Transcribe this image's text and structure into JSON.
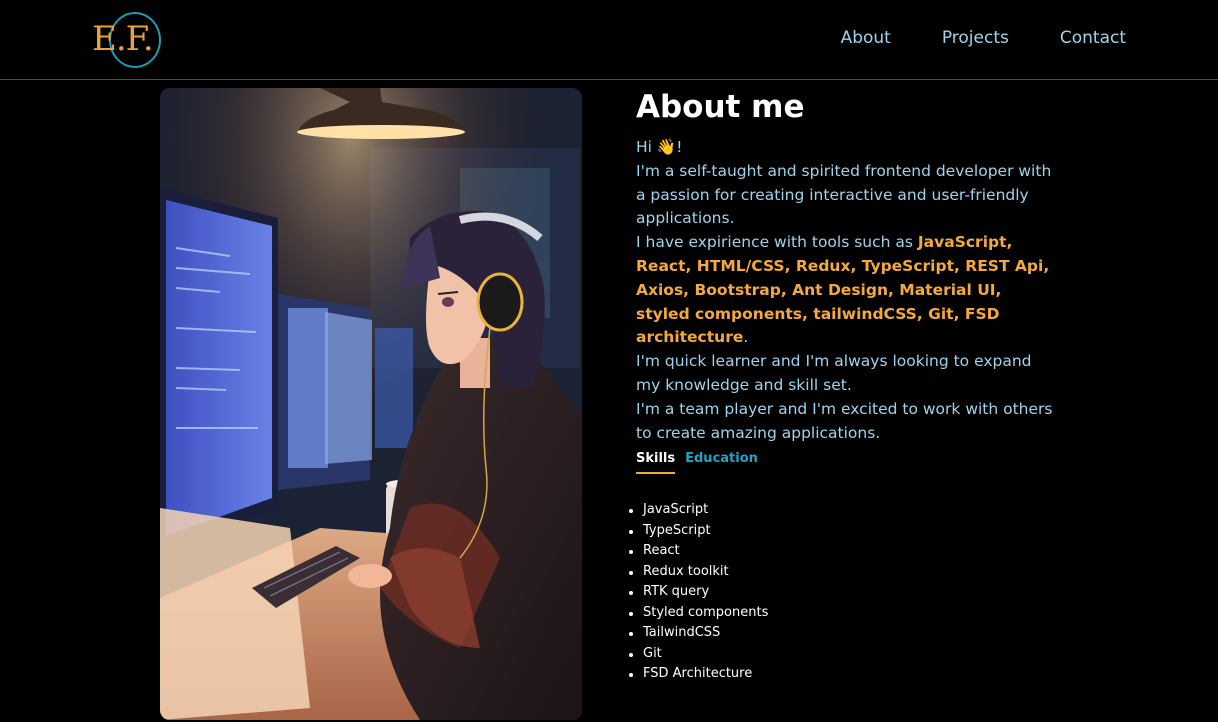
{
  "header": {
    "logo_text": "E.F.",
    "nav": [
      {
        "label": "About"
      },
      {
        "label": "Projects"
      },
      {
        "label": "Contact"
      }
    ]
  },
  "about": {
    "title": "About me",
    "greeting": "Hi 👋!",
    "intro": "I'm a self-taught and spirited frontend developer with a passion for creating interactive and user-friendly applications.",
    "tools_prefix": "I have expirience with tools such as ",
    "tools_list": "JavaScript, React, HTML/CSS, Redux, TypeScript, REST Api, Axios, Bootstrap, Ant Design, Material UI, styled components, tailwindCSS, Git, FSD architecture",
    "tools_suffix": ".",
    "learner": "I'm quick learner and I'm always looking to expand my knowledge and skill set.",
    "team": "I'm a team player and I'm excited to work with others to create amazing applications."
  },
  "tabs": [
    {
      "label": "Skills",
      "active": true
    },
    {
      "label": "Education",
      "active": false
    }
  ],
  "skills": [
    "JavaScript",
    "TypeScript",
    "React",
    "Redux toolkit",
    "RTK query",
    "Styled components",
    "TailwindCSS",
    "Git",
    "FSD Architecture"
  ],
  "colors": {
    "accent": "#f4a93d",
    "text_blue": "#9fd3ec",
    "tab_inactive": "#1fa3c7",
    "background": "#000000"
  }
}
